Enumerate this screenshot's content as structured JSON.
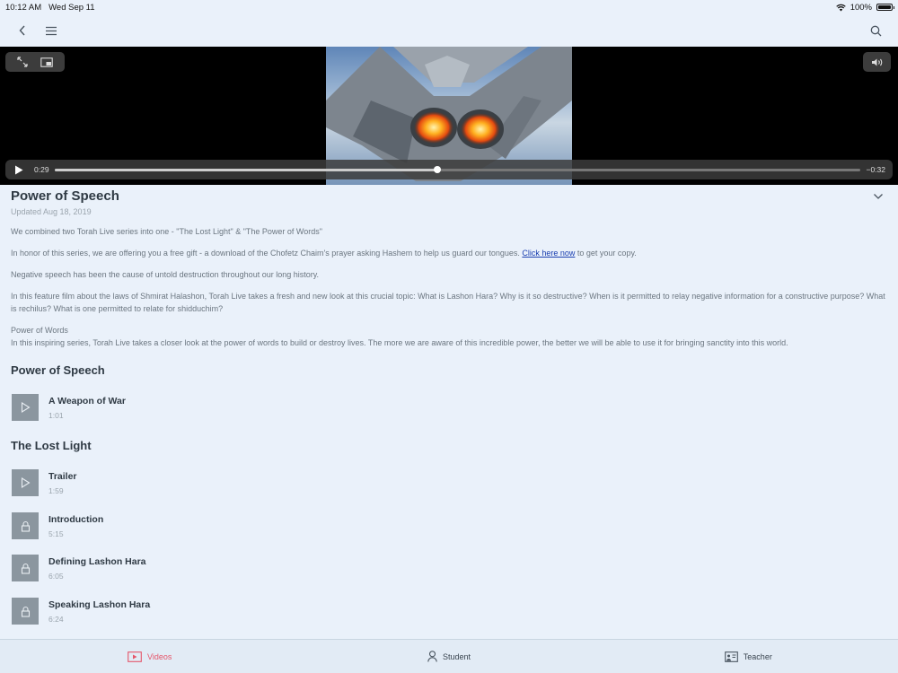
{
  "status": {
    "time": "10:12 AM",
    "date": "Wed Sep 11",
    "battery": "100%"
  },
  "player": {
    "elapsed": "0:29",
    "remaining": "−0:32",
    "progress": 0.475
  },
  "header": {
    "title": "Power of Speech",
    "updated": "Updated Aug 18, 2019"
  },
  "description": {
    "p1": "We combined two Torah Live series into one - \"The Lost Light\" & \"The Power of Words\"",
    "p2_before": "In honor of this series, we are offering you a free gift - a download of the Chofetz Chaim's prayer asking Hashem to help us guard our tongues. ",
    "p2_link": "Click here now",
    "p2_after": " to get your copy.",
    "p3": "Negative speech has been the cause of untold destruction throughout our long history.",
    "p4": "In this feature film about the laws of Shmirat Halashon, Torah Live takes a fresh and new look at this crucial topic: What is Lashon Hara? Why is it so destructive? When is it permitted to relay negative information for a constructive purpose? What is rechilus? What is one permitted to relate for shidduchim?",
    "p5_heading": "Power of Words",
    "p5": "In this inspiring series, Torah Live takes a closer look at the power of words to build or destroy lives. The more we are aware of this incredible power, the better we will be able to use it for bringing sanctity into this world."
  },
  "sections": [
    {
      "title": "Power of Speech",
      "episodes": [
        {
          "title": "A Weapon of War",
          "duration": "1:01",
          "locked": false
        }
      ]
    },
    {
      "title": "The Lost Light",
      "episodes": [
        {
          "title": "Trailer",
          "duration": "1:59",
          "locked": false
        },
        {
          "title": "Introduction",
          "duration": "5:15",
          "locked": true
        },
        {
          "title": "Defining Lashon Hara",
          "duration": "6:05",
          "locked": true
        },
        {
          "title": "Speaking Lashon Hara",
          "duration": "6:24",
          "locked": true
        }
      ]
    }
  ],
  "tabs": [
    {
      "label": "Videos",
      "active": true
    },
    {
      "label": "Student",
      "active": false
    },
    {
      "label": "Teacher",
      "active": false
    }
  ],
  "colors": {
    "accent": "#e5566b",
    "link": "#1a3fb0",
    "background": "#eaf1fa"
  }
}
